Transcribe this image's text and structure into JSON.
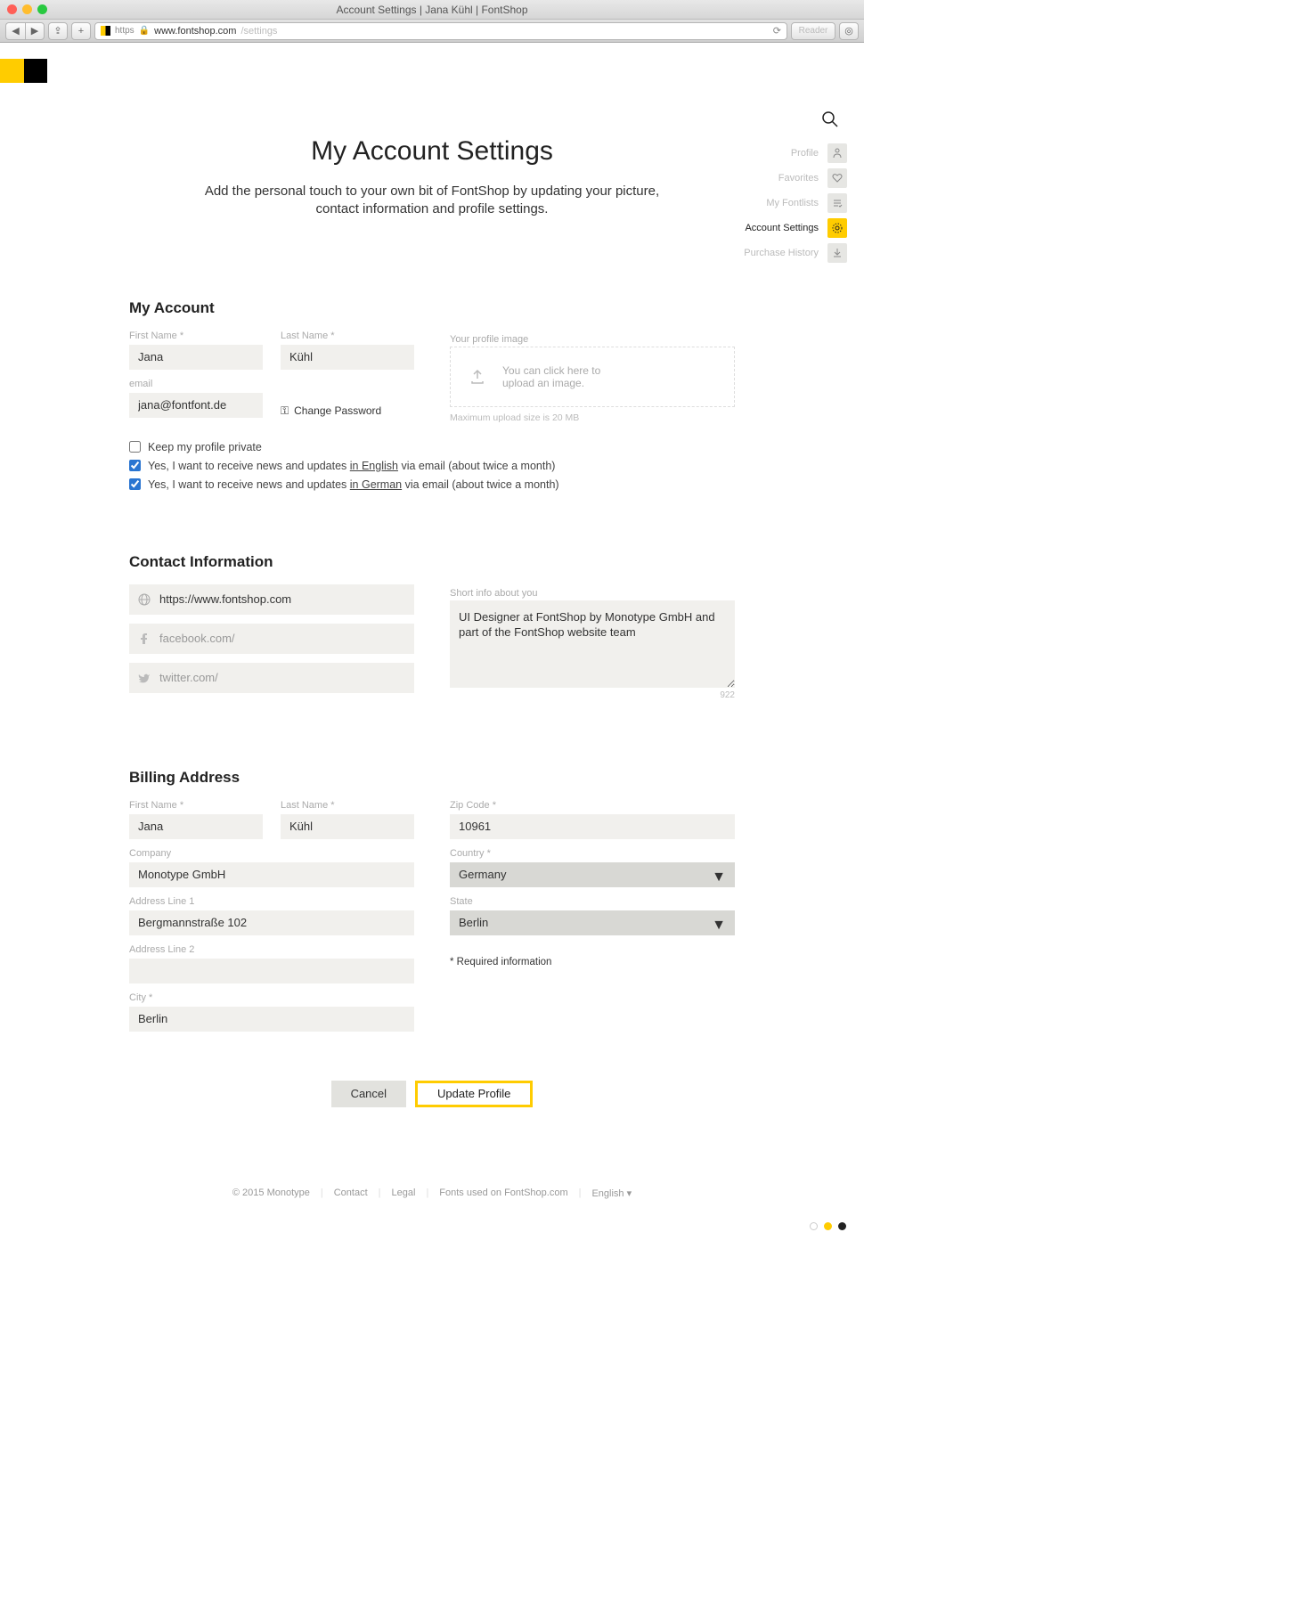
{
  "window_title": "Account Settings | Jana Kühl | FontShop",
  "url_host": "www.fontshop.com",
  "url_path": "/settings",
  "url_scheme": "https",
  "reader_label": "Reader",
  "page": {
    "title": "My Account Settings",
    "subtitle": "Add the personal touch to your own bit of FontShop by updating your picture, contact information and profile settings."
  },
  "sidenav": [
    {
      "label": "Profile",
      "active": false
    },
    {
      "label": "Favorites",
      "active": false
    },
    {
      "label": "My Fontlists",
      "active": false
    },
    {
      "label": "Account Settings",
      "active": true
    },
    {
      "label": "Purchase History",
      "active": false
    }
  ],
  "account": {
    "section_title": "My Account",
    "first_name_label": "First Name *",
    "first_name": "Jana",
    "last_name_label": "Last Name *",
    "last_name": "Kühl",
    "email_label": "email",
    "email": "jana@fontfont.de",
    "change_password": "Change Password",
    "profile_image_label": "Your profile image",
    "upload_text": "You can click here to upload an image.",
    "upload_hint": "Maximum upload size is 20 MB",
    "checks": {
      "private": {
        "checked": false,
        "text": "Keep my profile private"
      },
      "en": {
        "checked": true,
        "pre": "Yes, I want to receive news and updates ",
        "lang": "in English",
        "post": " via email (about twice a month)"
      },
      "de": {
        "checked": true,
        "pre": "Yes, I want to receive news and updates ",
        "lang": "in German",
        "post": " via email (about twice a month)"
      }
    }
  },
  "contact": {
    "section_title": "Contact Information",
    "website": "https://www.fontshop.com",
    "facebook_ph": "facebook.com/",
    "twitter_ph": "twitter.com/",
    "bio_label": "Short info about you",
    "bio": "UI Designer at FontShop by Monotype GmbH and part of the FontShop website team",
    "counter": "922"
  },
  "billing": {
    "section_title": "Billing Address",
    "first_name_label": "First Name *",
    "first_name": "Jana",
    "last_name_label": "Last Name *",
    "last_name": "Kühl",
    "company_label": "Company",
    "company": "Monotype GmbH",
    "addr1_label": "Address Line 1",
    "addr1": "Bergmannstraße 102",
    "addr2_label": "Address Line 2",
    "addr2": "",
    "city_label": "City *",
    "city": "Berlin",
    "zip_label": "Zip Code *",
    "zip": "10961",
    "country_label": "Country *",
    "country": "Germany",
    "state_label": "State",
    "state": "Berlin",
    "required_note": "* Required information"
  },
  "actions": {
    "cancel": "Cancel",
    "update": "Update Profile"
  },
  "footer": {
    "copyright": "© 2015 Monotype",
    "contact": "Contact",
    "legal": "Legal",
    "fonts": "Fonts used on FontShop.com",
    "lang": "English  ▾"
  }
}
